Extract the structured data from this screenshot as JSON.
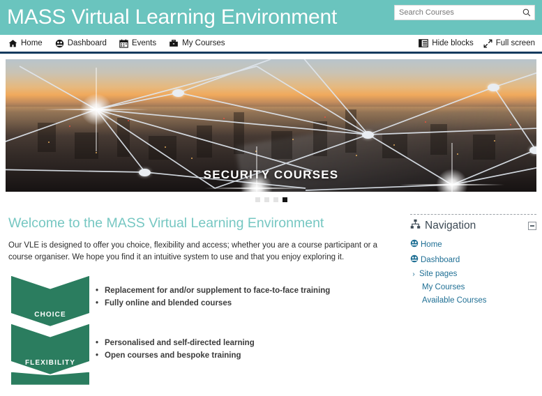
{
  "header": {
    "site_title": "MASS Virtual Learning Environment",
    "brand_color": "#6ac4be",
    "search": {
      "placeholder": "Search Courses",
      "value": "",
      "icon": "search-icon",
      "submit_label": "Search"
    }
  },
  "navbar": {
    "border_color": "#123a5e",
    "left_items": [
      {
        "label": "Home",
        "icon": "home-icon"
      },
      {
        "label": "Dashboard",
        "icon": "dashboard-icon"
      },
      {
        "label": "Events",
        "icon": "calendar-icon"
      },
      {
        "label": "My Courses",
        "icon": "briefcase-icon"
      }
    ],
    "right_items": [
      {
        "label": "Hide blocks",
        "icon": "hide-blocks-icon"
      },
      {
        "label": "Full screen",
        "icon": "full-screen-icon"
      }
    ]
  },
  "carousel": {
    "caption": "SECURITY COURSES",
    "slide_alt": "Aerial photo of London skyline at dusk overlaid with a white network of connected nodes",
    "slide_count": 4,
    "active_slide": 4,
    "indicators": [
      "1",
      "2",
      "3",
      "4"
    ]
  },
  "main": {
    "welcome_heading": "Welcome to the MASS Virtual Learning Environment",
    "welcome_body": "Our VLE is designed to offer you choice, flexibility and access; whether you are a course participant or a course organiser. We hope you find it an intuitive system to use and that you enjoy exploring it.",
    "heading_color": "#76c7c2",
    "infographic": {
      "accent_color": "#2b7d5f",
      "chevrons": [
        {
          "label": "CHOICE",
          "bullets": [
            "Replacement for and/or supplement to face-to-face training",
            "Fully online and blended courses"
          ]
        },
        {
          "label": "FLEXIBILITY",
          "bullets": [
            "Personalised and self-directed learning",
            "Open courses and bespoke training"
          ]
        }
      ]
    }
  },
  "sidebar": {
    "block": {
      "title": "Navigation",
      "icon": "sitemap-icon",
      "collapse_label": "",
      "items": [
        {
          "label": "Home",
          "icon": "dashboard-icon",
          "indent": false,
          "expandable": false
        },
        {
          "label": "Dashboard",
          "icon": "dashboard-icon",
          "indent": false,
          "expandable": false
        },
        {
          "label": "Site pages",
          "icon": "chevron-right-icon",
          "indent": false,
          "expandable": true
        },
        {
          "label": "My Courses",
          "icon": "",
          "indent": true,
          "expandable": false
        },
        {
          "label": "Available Courses",
          "icon": "",
          "indent": true,
          "expandable": false
        }
      ],
      "link_color": "#1f6f94"
    }
  }
}
